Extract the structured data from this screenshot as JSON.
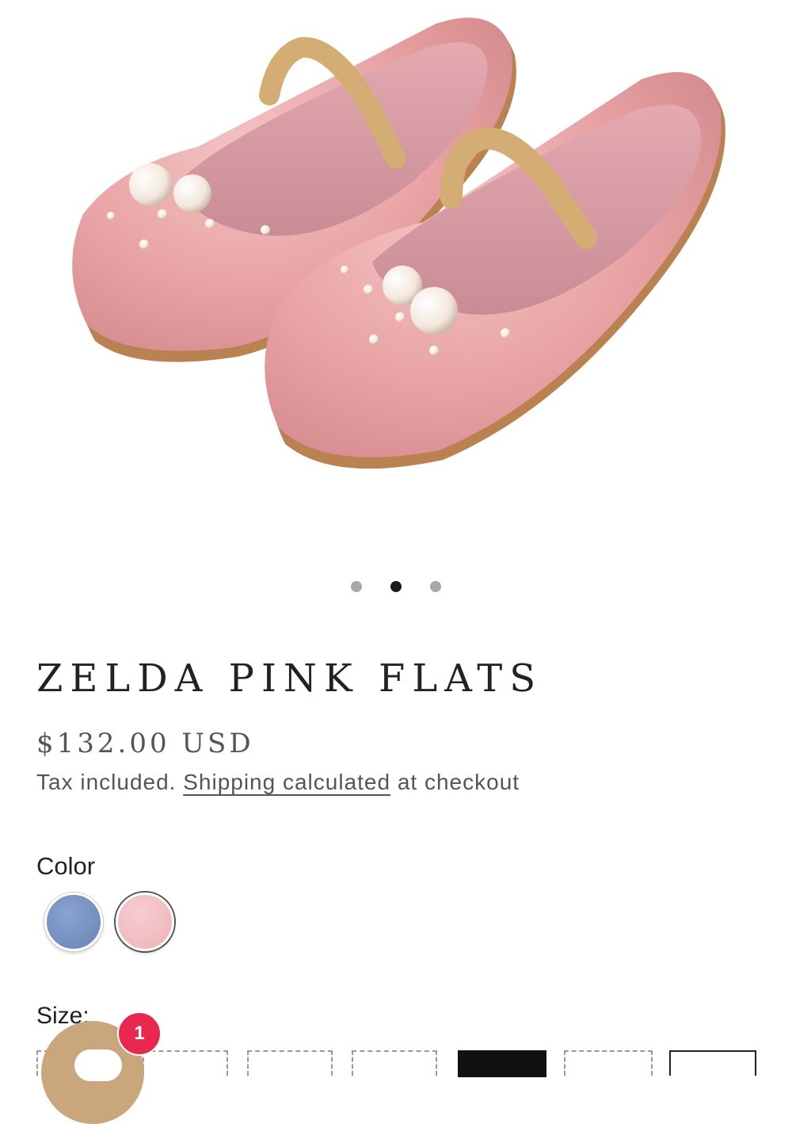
{
  "gallery": {
    "image_alt": "Zelda pink velvet flats with pearls",
    "slide_count": 3,
    "active_slide": 2
  },
  "product": {
    "title": "ZELDA PINK FLATS",
    "price": "$132.00 USD",
    "tax_prefix": "Tax included.",
    "shipping_link": "Shipping calculated",
    "tax_suffix": "at checkout"
  },
  "options": {
    "color_label": "Color",
    "colors": [
      {
        "name": "Blue",
        "hex": "#7590c2"
      },
      {
        "name": "Pink",
        "hex": "#f0bdc1",
        "selected": true
      }
    ],
    "size_label": "Size:"
  },
  "chat": {
    "badge_count": "1",
    "icon": "chat-bubble-icon",
    "accent": "#caa67c",
    "badge_color": "#e8284f"
  }
}
